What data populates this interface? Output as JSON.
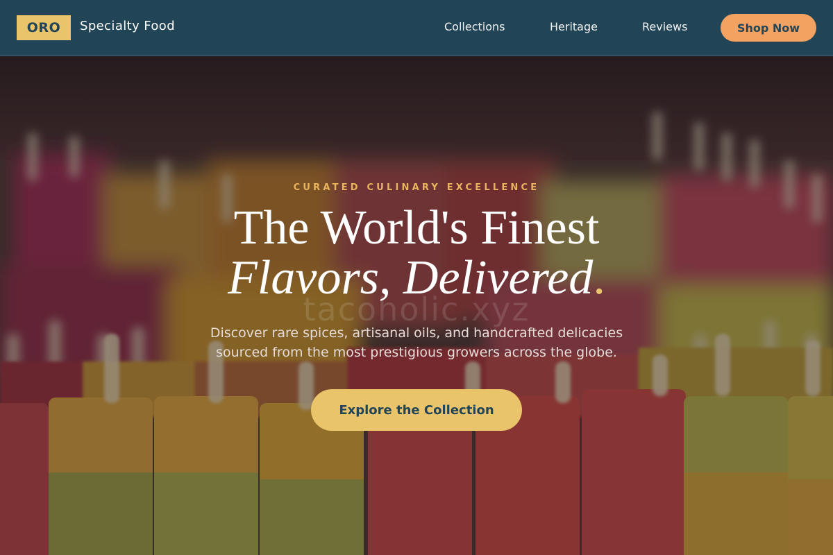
{
  "brand": {
    "badge": "ORO",
    "name": "Specialty Food"
  },
  "nav": {
    "links": [
      "Collections",
      "Heritage",
      "Reviews"
    ],
    "cta_label": "Shop Now"
  },
  "hero": {
    "eyebrow": "CURATED CULINARY EXCELLENCE",
    "headline_line1": "The World's Finest",
    "headline_line2": "Flavors, Delivered",
    "headline_period": ".",
    "subtitle_line1": "Discover rare spices, artisanal oils, and handcrafted delicacies",
    "subtitle_line2": "sourced from the most prestigious growers across the globe.",
    "cta_label": "Explore the Collection",
    "watermark": "tacoholic.xyz",
    "background_image": "popsicles-display"
  },
  "colors": {
    "nav_bg": "#214556",
    "accent_gold": "#e9c46a",
    "accent_orange": "#f4a261",
    "eyebrow": "#e9b45e"
  }
}
